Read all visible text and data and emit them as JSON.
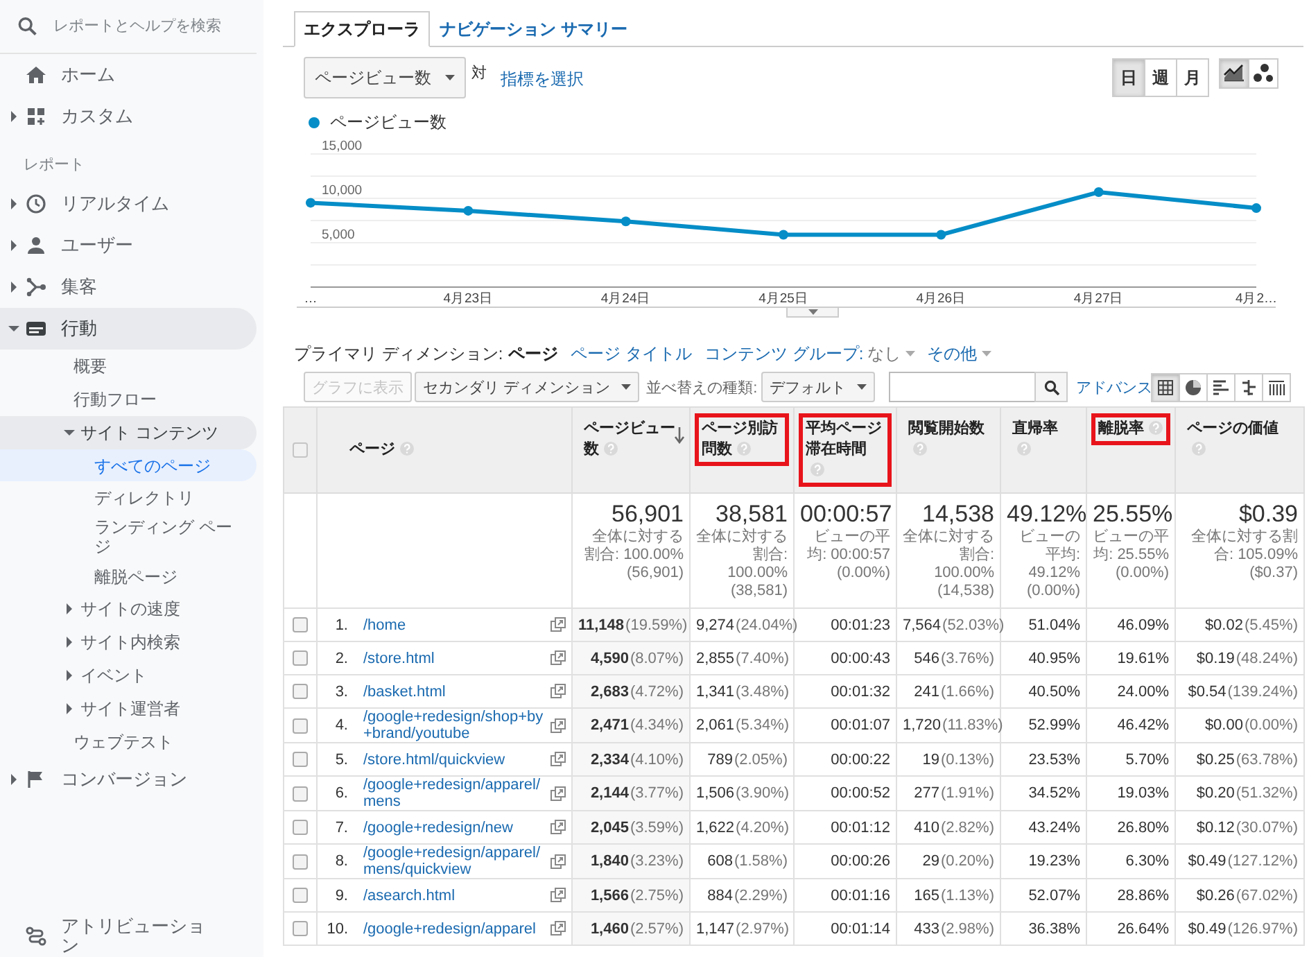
{
  "sidebar": {
    "search": {
      "placeholder": "レポートとヘルプを検索"
    },
    "top_items": [
      {
        "label": "ホーム",
        "kind": "link",
        "selected": false
      },
      {
        "label": "カスタム",
        "kind": "group",
        "expanded": false,
        "selected": false
      }
    ],
    "section_label": "レポート",
    "report_items": [
      {
        "label": "リアルタイム",
        "kind": "group",
        "expanded": false,
        "selected": false
      },
      {
        "label": "ユーザー",
        "kind": "group",
        "expanded": false,
        "selected": false
      },
      {
        "label": "集客",
        "kind": "group",
        "expanded": false,
        "selected": false
      },
      {
        "label": "行動",
        "kind": "group",
        "expanded": true,
        "selected": false,
        "children": [
          {
            "label": "概要",
            "kind": "link",
            "selected": false
          },
          {
            "label": "行動フロー",
            "kind": "link",
            "selected": false
          },
          {
            "label": "サイト コンテンツ",
            "kind": "group",
            "expanded": true,
            "selected": false,
            "children": [
              {
                "label": "すべてのページ",
                "kind": "link",
                "selected": true
              },
              {
                "label": "ディレクトリ",
                "kind": "link",
                "selected": false
              },
              {
                "label": "ランディング ページ",
                "kind": "link",
                "selected": false
              },
              {
                "label": "離脱ページ",
                "kind": "link",
                "selected": false
              }
            ]
          },
          {
            "label": "サイトの速度",
            "kind": "group",
            "expanded": false,
            "selected": false
          },
          {
            "label": "サイト内検索",
            "kind": "group",
            "expanded": false,
            "selected": false
          },
          {
            "label": "イベント",
            "kind": "group",
            "expanded": false,
            "selected": false
          },
          {
            "label": "サイト運営者",
            "kind": "group",
            "expanded": false,
            "selected": false
          },
          {
            "label": "ウェブテスト",
            "kind": "link",
            "selected": false
          }
        ]
      },
      {
        "label": "コンバージョン",
        "kind": "group",
        "expanded": false,
        "selected": false
      }
    ],
    "bottom_items": [
      {
        "label": "アトリビューション",
        "kind": "link",
        "selected": false
      }
    ]
  },
  "explorer": {
    "tabs": [
      {
        "label": "エクスプローラ",
        "selected": true
      },
      {
        "label": "ナビゲーション サマリー",
        "selected": false
      }
    ],
    "metric_select": "ページビュー数",
    "versus": "対",
    "metric_link": "指標を選択",
    "periods": [
      {
        "label": "日",
        "selected": true
      },
      {
        "label": "週",
        "selected": false
      },
      {
        "label": "月",
        "selected": false
      }
    ],
    "chart_modes": [
      {
        "selected": true
      },
      {
        "selected": false
      }
    ],
    "chart_data": {
      "type": "line",
      "categories": [
        "…",
        "4月23日",
        "4月24日",
        "4月25日",
        "4月26日",
        "4月27日",
        "4月2…"
      ],
      "series": [
        {
          "name": "ページビュー数",
          "color": "#058dc7",
          "marker": true,
          "values": [
            9500,
            8600,
            7400,
            5900,
            5900,
            10700,
            8900
          ]
        }
      ],
      "ylim": [
        0,
        15000
      ],
      "yticks": [
        {
          "value": 5000,
          "label": "5,000"
        },
        {
          "value": 10000,
          "label": "10,000"
        },
        {
          "value": 15000,
          "label": "15,000"
        }
      ]
    }
  },
  "dimensions": {
    "label": "プライマリ ディメンション:",
    "options": [
      {
        "label": "ページ",
        "kind": "link",
        "selected": true
      },
      {
        "label": "ページ タイトル",
        "kind": "link",
        "selected": false
      },
      {
        "label": "コンテンツ グループ:",
        "value": "なし",
        "kind": "menu",
        "selected": false
      },
      {
        "label": "その他",
        "kind": "menu",
        "selected": false
      }
    ]
  },
  "toolbar": {
    "plot_button": {
      "label": "グラフに表示",
      "disabled": true
    },
    "secondary_dimension": "セカンダリ ディメンション",
    "sort_label": "並べ替えの種類:",
    "sort_select": "デフォルト",
    "advanced_link": "アドバンス",
    "views": [
      {
        "selected": true
      },
      {
        "selected": false
      },
      {
        "selected": false
      },
      {
        "selected": false
      },
      {
        "selected": false
      }
    ]
  },
  "table": {
    "select_all_checked": false,
    "page_column": {
      "label": "ページ",
      "help": true,
      "highlighted": false
    },
    "columns": [
      {
        "label": "ページビュー数",
        "help": true,
        "sorted": true,
        "highlighted": false
      },
      {
        "label": "ページ別訪問数",
        "help": true,
        "sorted": false,
        "highlighted": true
      },
      {
        "label": "平均ページ滞在時間",
        "help": true,
        "sorted": false,
        "highlighted": true
      },
      {
        "label": "閲覧開始数",
        "help": true,
        "sorted": false,
        "highlighted": false
      },
      {
        "label": "直帰率",
        "help": true,
        "sorted": false,
        "highlighted": false
      },
      {
        "label": "離脱率",
        "help": true,
        "sorted": false,
        "highlighted": true
      },
      {
        "label": "ページの価値",
        "help": true,
        "sorted": false,
        "highlighted": false
      }
    ],
    "totals": [
      {
        "value": "56,901",
        "note": "全体に対する割合: 100.00% (56,901)"
      },
      {
        "value": "38,581",
        "note": "全体に対する割合: 100.00% (38,581)"
      },
      {
        "value": "00:00:57",
        "note": "ビューの平均: 00:00:57 (0.00%)"
      },
      {
        "value": "14,538",
        "note": "全体に対する割合: 100.00% (14,538)"
      },
      {
        "value": "49.12%",
        "note": "ビューの平均: 49.12% (0.00%)"
      },
      {
        "value": "25.55%",
        "note": "ビューの平均: 25.55% (0.00%)"
      },
      {
        "value": "$0.39",
        "note": "全体に対する割合: 105.09% ($0.37)"
      }
    ],
    "rows": [
      {
        "checked": false,
        "index": "1.",
        "page": "/home",
        "cells": [
          {
            "value": "11,148",
            "share": "(19.59%)"
          },
          {
            "value": "9,274",
            "share": "(24.04%)"
          },
          {
            "value": "00:01:23"
          },
          {
            "value": "7,564",
            "share": "(52.03%)"
          },
          {
            "value": "51.04%"
          },
          {
            "value": "46.09%"
          },
          {
            "value": "$0.02",
            "share": "(5.45%)"
          }
        ]
      },
      {
        "checked": false,
        "index": "2.",
        "page": "/store.html",
        "cells": [
          {
            "value": "4,590",
            "share": "(8.07%)"
          },
          {
            "value": "2,855",
            "share": "(7.40%)"
          },
          {
            "value": "00:00:43"
          },
          {
            "value": "546",
            "share": "(3.76%)"
          },
          {
            "value": "40.95%"
          },
          {
            "value": "19.61%"
          },
          {
            "value": "$0.19",
            "share": "(48.24%)"
          }
        ]
      },
      {
        "checked": false,
        "index": "3.",
        "page": "/basket.html",
        "cells": [
          {
            "value": "2,683",
            "share": "(4.72%)"
          },
          {
            "value": "1,341",
            "share": "(3.48%)"
          },
          {
            "value": "00:01:32"
          },
          {
            "value": "241",
            "share": "(1.66%)"
          },
          {
            "value": "40.50%"
          },
          {
            "value": "24.00%"
          },
          {
            "value": "$0.54",
            "share": "(139.24%)"
          }
        ]
      },
      {
        "checked": false,
        "index": "4.",
        "page": "/google+redesign/shop+by+brand/youtube",
        "cells": [
          {
            "value": "2,471",
            "share": "(4.34%)"
          },
          {
            "value": "2,061",
            "share": "(5.34%)"
          },
          {
            "value": "00:01:07"
          },
          {
            "value": "1,720",
            "share": "(11.83%)"
          },
          {
            "value": "52.99%"
          },
          {
            "value": "46.42%"
          },
          {
            "value": "$0.00",
            "share": "(0.00%)"
          }
        ]
      },
      {
        "checked": false,
        "index": "5.",
        "page": "/store.html/quickview",
        "cells": [
          {
            "value": "2,334",
            "share": "(4.10%)"
          },
          {
            "value": "789",
            "share": "(2.05%)"
          },
          {
            "value": "00:00:22"
          },
          {
            "value": "19",
            "share": "(0.13%)"
          },
          {
            "value": "23.53%"
          },
          {
            "value": "5.70%"
          },
          {
            "value": "$0.25",
            "share": "(63.78%)"
          }
        ]
      },
      {
        "checked": false,
        "index": "6.",
        "page": "/google+redesign/apparel/mens",
        "cells": [
          {
            "value": "2,144",
            "share": "(3.77%)"
          },
          {
            "value": "1,506",
            "share": "(3.90%)"
          },
          {
            "value": "00:00:52"
          },
          {
            "value": "277",
            "share": "(1.91%)"
          },
          {
            "value": "34.52%"
          },
          {
            "value": "19.03%"
          },
          {
            "value": "$0.20",
            "share": "(51.32%)"
          }
        ]
      },
      {
        "checked": false,
        "index": "7.",
        "page": "/google+redesign/new",
        "cells": [
          {
            "value": "2,045",
            "share": "(3.59%)"
          },
          {
            "value": "1,622",
            "share": "(4.20%)"
          },
          {
            "value": "00:01:12"
          },
          {
            "value": "410",
            "share": "(2.82%)"
          },
          {
            "value": "43.24%"
          },
          {
            "value": "26.80%"
          },
          {
            "value": "$0.12",
            "share": "(30.07%)"
          }
        ]
      },
      {
        "checked": false,
        "index": "8.",
        "page": "/google+redesign/apparel/mens/quickview",
        "cells": [
          {
            "value": "1,840",
            "share": "(3.23%)"
          },
          {
            "value": "608",
            "share": "(1.58%)"
          },
          {
            "value": "00:00:26"
          },
          {
            "value": "29",
            "share": "(0.20%)"
          },
          {
            "value": "19.23%"
          },
          {
            "value": "6.30%"
          },
          {
            "value": "$0.49",
            "share": "(127.12%)"
          }
        ]
      },
      {
        "checked": false,
        "index": "9.",
        "page": "/asearch.html",
        "cells": [
          {
            "value": "1,566",
            "share": "(2.75%)"
          },
          {
            "value": "884",
            "share": "(2.29%)"
          },
          {
            "value": "00:01:16"
          },
          {
            "value": "165",
            "share": "(1.13%)"
          },
          {
            "value": "52.07%"
          },
          {
            "value": "28.86%"
          },
          {
            "value": "$0.26",
            "share": "(67.02%)"
          }
        ]
      },
      {
        "checked": false,
        "index": "10.",
        "page": "/google+redesign/apparel",
        "cells": [
          {
            "value": "1,460",
            "share": "(2.57%)"
          },
          {
            "value": "1,147",
            "share": "(2.97%)"
          },
          {
            "value": "00:01:14"
          },
          {
            "value": "433",
            "share": "(2.98%)"
          },
          {
            "value": "36.38%"
          },
          {
            "value": "26.64%"
          },
          {
            "value": "$0.49",
            "share": "(126.97%)"
          }
        ]
      }
    ]
  }
}
